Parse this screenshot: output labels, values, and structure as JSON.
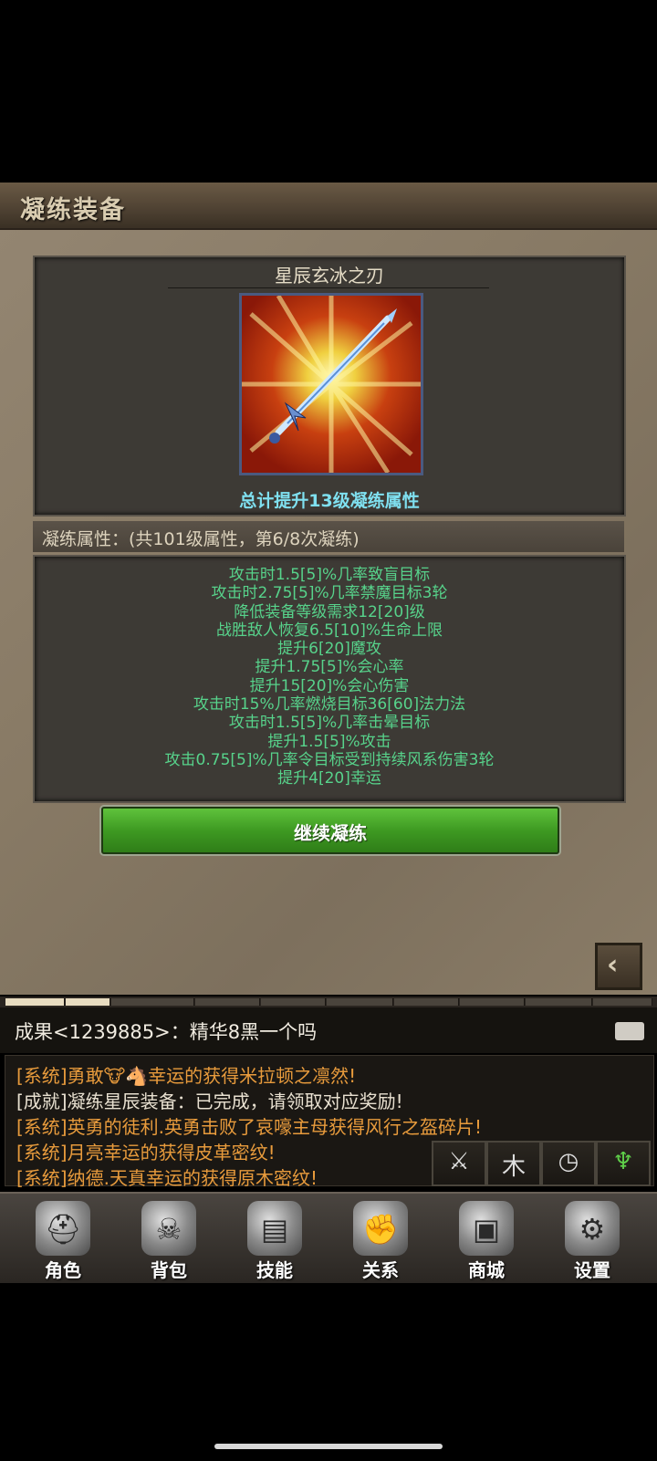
{
  "header": {
    "title": "凝练装备"
  },
  "item": {
    "name": "星辰玄冰之刃",
    "total_text": "总计提升13级凝练属性"
  },
  "refine": {
    "summary": "凝练属性：(共101级属性，第6/8次凝练)",
    "stats": [
      "攻击时1.5[5]%几率致盲目标",
      "攻击时2.75[5]%几率禁魔目标3轮",
      "降低装备等级需求12[20]级",
      "战胜敌人恢复6.5[10]%生命上限",
      "提升6[20]魔攻",
      "提升1.75[5]%会心率",
      "提升15[20]%会心伤害",
      "攻击时15%几率燃烧目标36[60]法力法",
      "攻击时1.5[5]%几率击晕目标",
      "提升1.5[5]%攻击",
      "攻击0.75[5]%几率令目标受到持续风系伤害3轮",
      "提升4[20]幸运"
    ],
    "continue_label": "继续凝练",
    "back_icon": "chevron-left-icon"
  },
  "chat": {
    "input_text": "成果<1239885>：精华8黑一个吗",
    "log": [
      {
        "text": "[系统]勇敢🐮🐴幸运的获得米拉顿之凛然!",
        "color": "#e89b3c"
      },
      {
        "text": "[成就]凝练星辰装备：已完成，请领取对应奖励!",
        "color": "#e8e0d0"
      },
      {
        "text": "[系统]英勇的徒利.英勇击败了哀嚎主母获得风行之盔碎片!",
        "color": "#e89b3c"
      },
      {
        "text": "[系统]月亮幸运的获得皮革密纹!",
        "color": "#e89b3c"
      },
      {
        "text": "[系统]纳德.天真幸运的获得原木密纹!",
        "color": "#e89b3c"
      }
    ],
    "quick_icons": [
      "crossed-swords-icon",
      "wood-icon",
      "clock-icon",
      "trophy-icon"
    ]
  },
  "nav": [
    {
      "label": "角色",
      "icon": "helmet-icon"
    },
    {
      "label": "背包",
      "icon": "backpack-icon"
    },
    {
      "label": "技能",
      "icon": "spellbook-icon"
    },
    {
      "label": "关系",
      "icon": "handshake-icon"
    },
    {
      "label": "商城",
      "icon": "chest-icon"
    },
    {
      "label": "设置",
      "icon": "gear-icon"
    }
  ],
  "colors": {
    "stat_green": "#57d38b",
    "total_cyan": "#7fe0f0",
    "system_orange": "#e89b3c",
    "button_green": "#3e9a22"
  }
}
